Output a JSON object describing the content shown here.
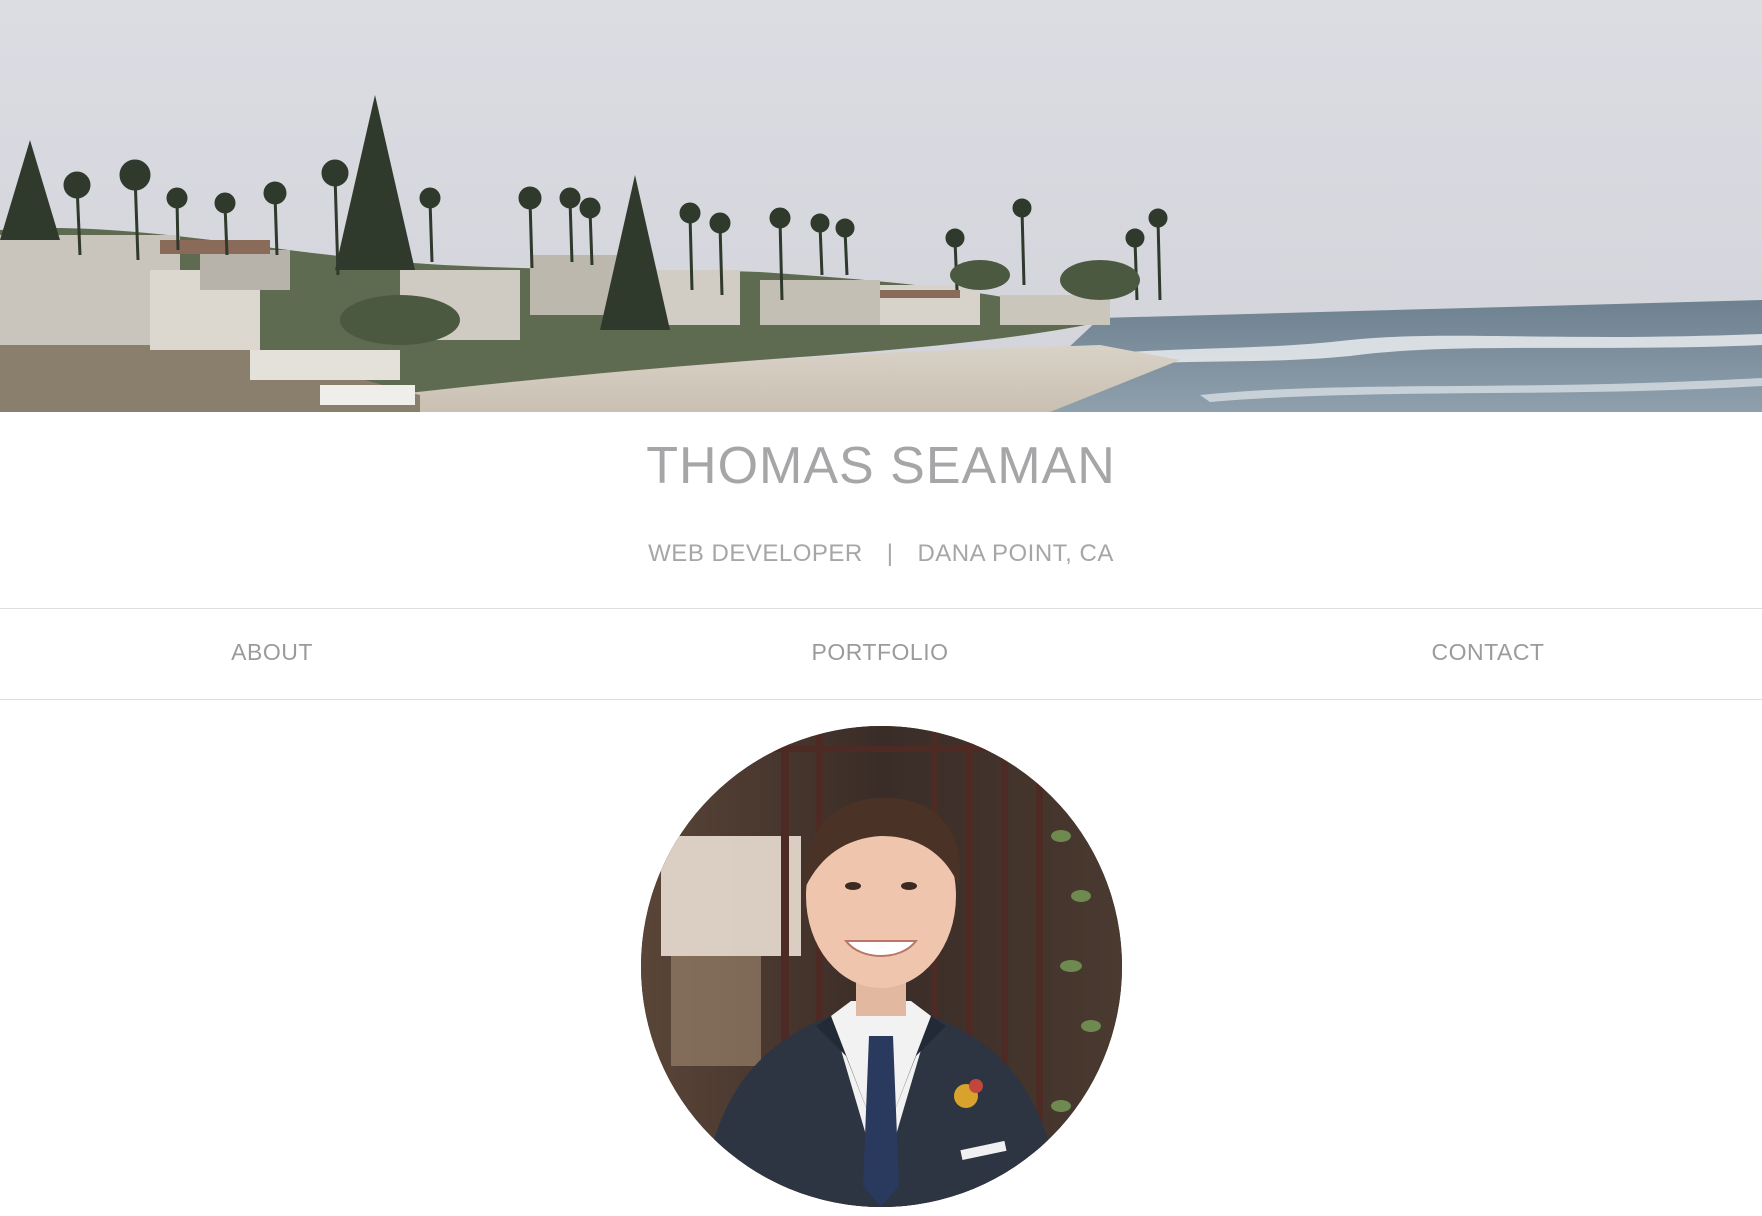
{
  "banner": {
    "image": "coastal-beach-town-photo"
  },
  "site": {
    "title": "THOMAS SEAMAN",
    "role": "WEB DEVELOPER",
    "separator": "|",
    "location": "DANA POINT, CA"
  },
  "nav": {
    "items": [
      {
        "label": "ABOUT"
      },
      {
        "label": "PORTFOLIO"
      },
      {
        "label": "CONTACT"
      }
    ]
  },
  "profile": {
    "photo": "portrait-man-in-suit"
  },
  "colors": {
    "text": "#a6a6a8",
    "divider": "#dedede",
    "background": "#ffffff"
  }
}
